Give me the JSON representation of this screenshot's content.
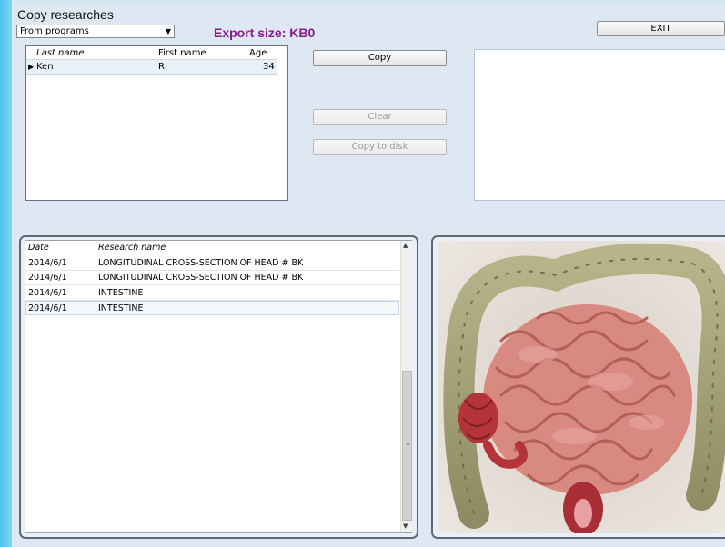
{
  "window": {
    "title": "Copy researches"
  },
  "source_select": {
    "value": "From programs"
  },
  "export": {
    "label": "Export size:",
    "value": "KB0"
  },
  "buttons": {
    "exit": "EXIT",
    "copy": "Copy",
    "clear": "Clear",
    "copy_to_disk": "Copy to disk"
  },
  "patients": {
    "columns": [
      "Last name",
      "First name",
      "Age"
    ],
    "rows": [
      {
        "last_name": "Ken",
        "first_name": "R",
        "age": "34"
      }
    ]
  },
  "researches": {
    "columns": [
      "Date",
      "Research name"
    ],
    "rows": [
      {
        "date": "2014/6/1",
        "name": "LONGITUDINAL CROSS-SECTION OF HEAD # BK"
      },
      {
        "date": "2014/6/1",
        "name": "LONGITUDINAL CROSS-SECTION OF HEAD # BK"
      },
      {
        "date": "2014/6/1",
        "name": "INTESTINE"
      },
      {
        "date": "2014/6/1",
        "name": "INTESTINE"
      }
    ]
  },
  "colors": {
    "export_label": "#8a1a8a",
    "left_edge": "#4fc3f0",
    "background": "#dde8f3"
  },
  "icons": {
    "row_pointer": "row-pointer-icon",
    "dropdown": "chevron-down-icon"
  }
}
